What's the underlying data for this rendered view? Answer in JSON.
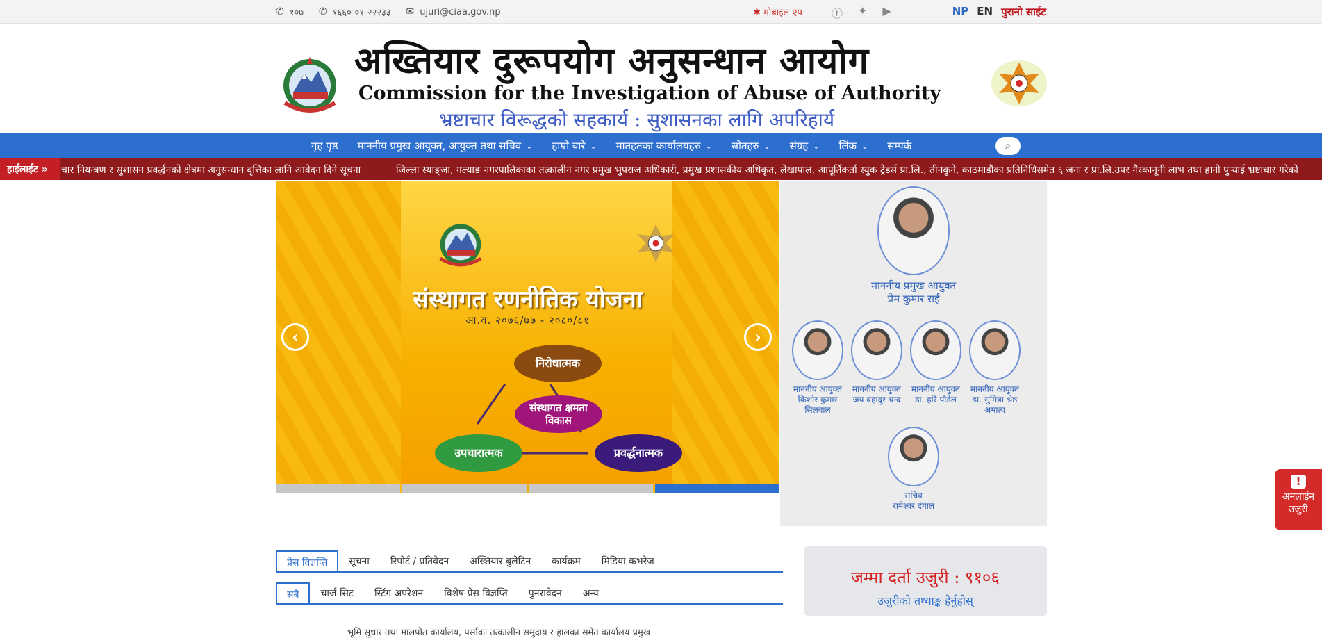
{
  "topbar": {
    "phone1": "१०७",
    "phone2": "१६६०-०१-२२२३३",
    "email": "ujuri@ciaa.gov.np",
    "mobile_app": "मोबाइल एप",
    "lang_np": "NP",
    "lang_en": "EN",
    "old_site": "पुरानो साईट"
  },
  "header": {
    "title_np": "अख्तियार दुरूपयोग अनुसन्धान आयोग",
    "title_en": "Commission for the Investigation of Abuse of Authority",
    "tagline": "भ्रष्टाचार विरूद्धको सहकार्य : सुशासनका लागि अपरिहार्य"
  },
  "nav": {
    "items": [
      {
        "label": "गृह पृष्ठ",
        "dropdown": false
      },
      {
        "label": "माननीय प्रमुख आयुक्त, आयुक्त तथा सचिव",
        "dropdown": true
      },
      {
        "label": "हाम्रो बारे",
        "dropdown": true
      },
      {
        "label": "मातहतका कार्यालयहरु",
        "dropdown": true
      },
      {
        "label": "स्रोतहरु",
        "dropdown": true
      },
      {
        "label": "संग्रह",
        "dropdown": true
      },
      {
        "label": "लिंक",
        "dropdown": true
      },
      {
        "label": "सम्पर्क",
        "dropdown": false
      }
    ]
  },
  "ticker": {
    "label": "हाईलाईट »",
    "item1": "चार नियन्त्रण र सुशासन प्रवर्द्धनको क्षेत्रमा अनुसन्धान वृत्तिका लागि आवेदन दिने सूचना",
    "item2": "जिल्ला स्याङ्जा, गल्याङ नगरपालिकाका तत्कालीन नगर प्रमुख भुपराज अधिकारी, प्रमुख प्रशासकीय अधिकृत, लेखापाल, आपूर्तिकर्ता स्युक ट्रेडर्स प्रा.लि., तीनकुने, काठमाडौंका प्रतिनिधिसमेत ६ जना र प्रा.लि.उपर गैरकानूनी लाभ तथा हानी पुऱ्याई भ्रष्टाचार गरेको"
  },
  "slider": {
    "title": "संस्थागत रणनीतिक योजना",
    "year": "आ.व. २०७६/७७ - २०८०/८१",
    "nodes": {
      "top": "निरोधात्मक",
      "center": "संस्थागत क्षमता विकास",
      "left": "उपचारात्मक",
      "right": "प्रवर्द्धनात्मक"
    },
    "slide_count": 4,
    "active_slide": 4
  },
  "officials": {
    "chief": {
      "title": "माननीय प्रमुख आयुक्त",
      "name": "प्रेम कुमार राई"
    },
    "commissioners": [
      {
        "title": "माननीय आयुक्त",
        "name": "किशोर कुमार सिलवाल"
      },
      {
        "title": "माननीय आयुक्त",
        "name": "जय बहादुर चन्द"
      },
      {
        "title": "माननीय आयुक्त",
        "name": "डा. हरि पौडेल"
      },
      {
        "title": "माननीय आयुक्त",
        "name": "डा. सुमित्रा श्रेष्ठ अमात्य"
      }
    ],
    "secretary": {
      "title": "सचिव",
      "name": "रामेश्वर दंगाल"
    }
  },
  "tabs": {
    "row1": [
      "प्रेस विज्ञप्ति",
      "सूचना",
      "रिपोर्ट / प्रतिवेदन",
      "अख्तियार बुलेटिन",
      "कार्यक्रम",
      "मिडिया कभरेज"
    ],
    "row2": [
      "सबै",
      "चार्ज सिट",
      "स्टिंग अपरेशन",
      "विशेष प्रेस विज्ञप्ति",
      "पुनरावेदन",
      "अन्य"
    ],
    "preview": "भूमि सुधार तथा मालपोत कार्यालय, पर्साका तत्कालीन समुदाय र हालका समेत कार्यालय प्रमुख"
  },
  "complaint": {
    "count": "जम्मा दर्ता उजुरी : ९१०६",
    "link": "उजुरीको तथ्याङ्क हेर्नुहोस्"
  },
  "online_complaint": {
    "line1": "अनलाईन",
    "line2": "उजुरी"
  },
  "colors": {
    "nav_blue": "#2d6fcf",
    "ticker_red": "#8f1a1c",
    "accent_red": "#d42a2a"
  }
}
